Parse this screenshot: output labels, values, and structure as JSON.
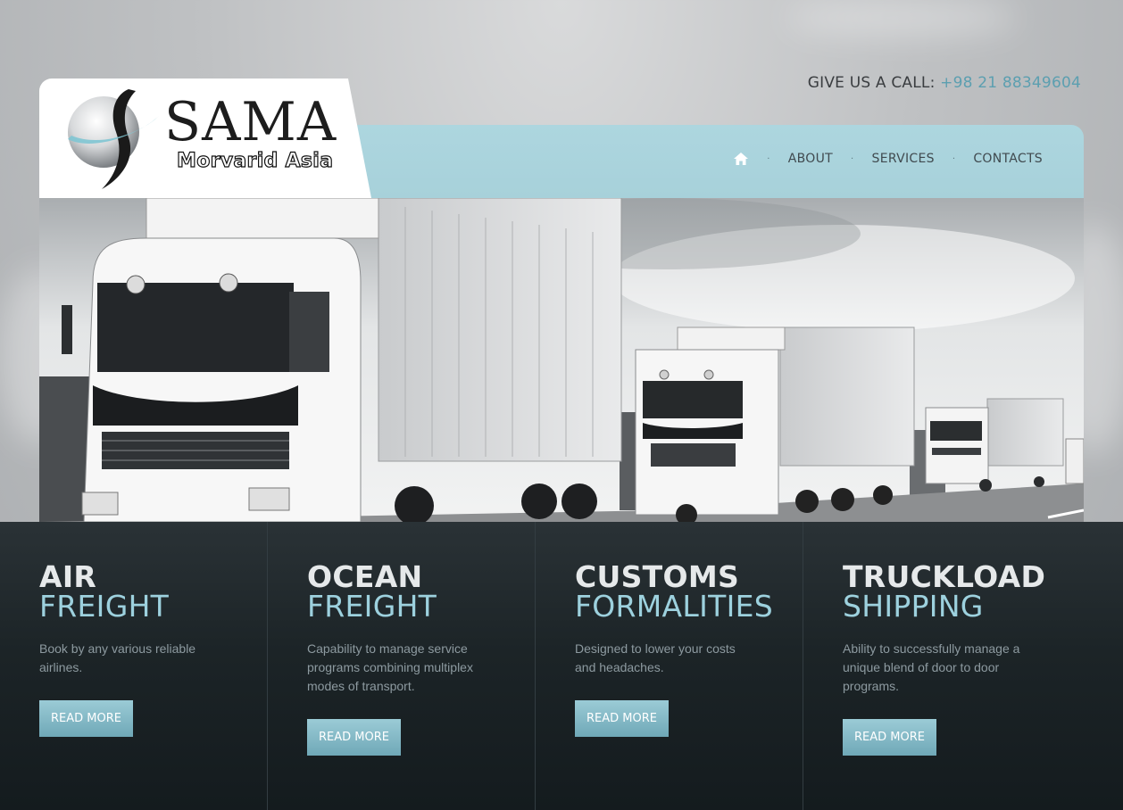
{
  "header": {
    "call_label": "GIVE US A CALL:",
    "phone": "+98 21 88349604"
  },
  "logo": {
    "title": "SAMA",
    "subtitle": "Morvarid Asia"
  },
  "nav": {
    "items": [
      "ABOUT",
      "SERVICES",
      "CONTACTS"
    ]
  },
  "hero": {
    "image": "white trucks on highway"
  },
  "services": [
    {
      "title_line1": "AIR",
      "title_line2": "FREIGHT",
      "description": "Book by any various reliable airlines.",
      "button": "READ MORE"
    },
    {
      "title_line1": "OCEAN",
      "title_line2": "FREIGHT",
      "description": "Capability to manage service programs combining multiplex modes of transport.",
      "button": "READ MORE"
    },
    {
      "title_line1": "CUSTOMS",
      "title_line2": "FORMALITIES",
      "description": "Designed to lower your costs and headaches.",
      "button": "READ MORE"
    },
    {
      "title_line1": "TRUCKLOAD",
      "title_line2": "SHIPPING",
      "description": "Ability to successfully manage a unique blend of door to door programs.",
      "button": "READ MORE"
    }
  ],
  "colors": {
    "accent": "#5c9fb0",
    "nav_bg": "#a9d3dc",
    "service_title_light": "#9dd1de",
    "service_bg": "#1c2427"
  }
}
